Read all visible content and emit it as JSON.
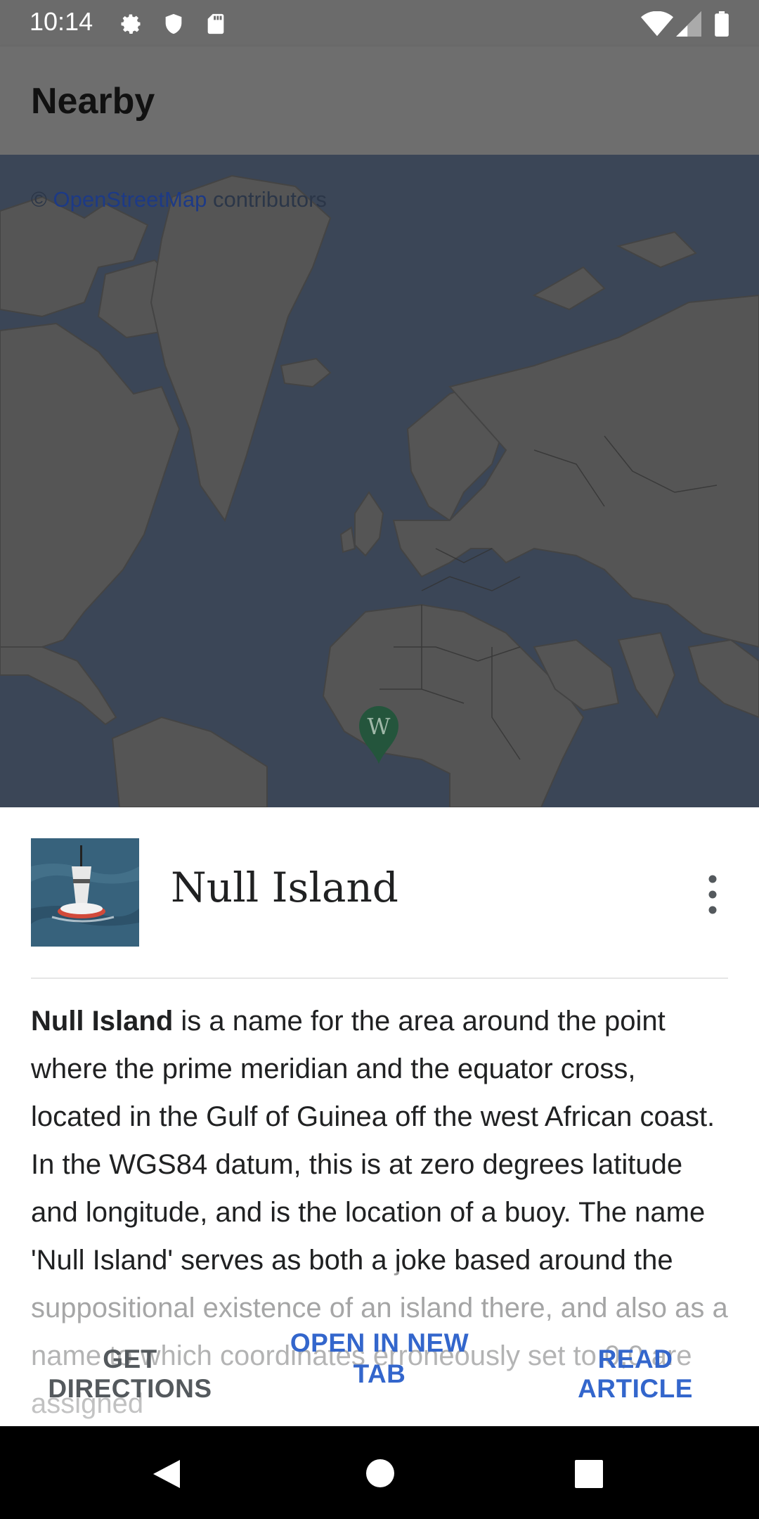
{
  "status_bar": {
    "time": "10:14",
    "left_icons": [
      "gear-icon",
      "shield-icon",
      "sd-card-icon"
    ],
    "right_icons": [
      "wifi-icon",
      "cell-signal-icon",
      "battery-icon"
    ]
  },
  "app_bar": {
    "title": "Nearby"
  },
  "map": {
    "attribution_prefix": "©",
    "attribution_link": "OpenStreetMap",
    "attribution_suffix": "contributors",
    "marker_icon": "wikipedia-pin-icon",
    "marker_letter": "W"
  },
  "sheet": {
    "title": "Null Island",
    "extract_bold": "Null Island",
    "extract_rest": " is a name for the area around the point where the prime meridian and the equator cross, located in the Gulf of Guinea off the west African coast. In the WGS84 datum, this is at zero degrees latitude and longitude, and is the location of a buoy. The name 'Null Island' serves as both a joke based around the suppositional existence of an island there, and also as a name to which coordinates erroneously set to 0,0 are assigned",
    "actions": {
      "directions": "GET DIRECTIONS",
      "new_tab_line1": "OPEN IN NEW",
      "new_tab_line2": "TAB",
      "read": "READ ARTICLE"
    }
  },
  "colors": {
    "accent": "#3366cc",
    "muted_action": "#54595d",
    "map_water": "#3b4657",
    "map_land": "#555555"
  }
}
